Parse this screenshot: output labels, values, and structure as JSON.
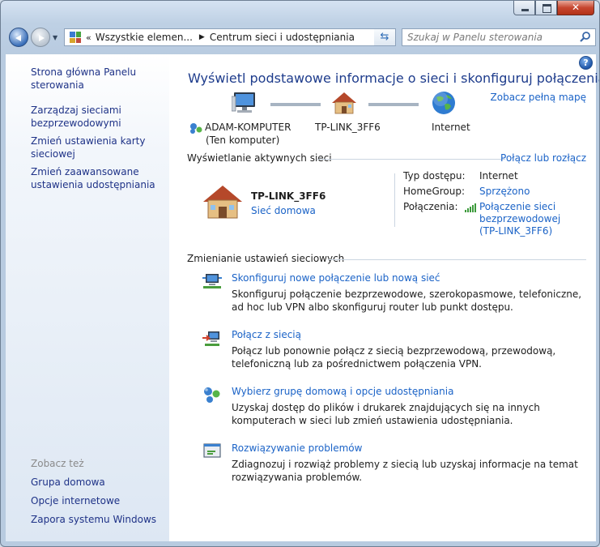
{
  "window": {
    "controls": {
      "minimize": "minimize",
      "maximize": "maximize",
      "close": "close"
    }
  },
  "address_bar": {
    "chevron": "«",
    "crumbs": [
      "Wszystkie elemen...",
      "Centrum sieci i udostępniania"
    ],
    "search_placeholder": "Szukaj w Panelu sterowania"
  },
  "sidebar": {
    "links": [
      "Strona główna Panelu sterowania",
      "Zarządzaj sieciami bezprzewodowymi",
      "Zmień ustawienia karty sieciowej",
      "Zmień zaawansowane ustawienia udostępniania"
    ],
    "see_also_label": "Zobacz też",
    "see_also_links": [
      "Grupa domowa",
      "Opcje internetowe",
      "Zapora systemu Windows"
    ]
  },
  "main": {
    "title": "Wyświetl podstawowe informacje o sieci i skonfiguruj połączenia",
    "full_map_link": "Zobacz pełną mapę",
    "map": {
      "computer_name": "ADAM-KOMPUTER",
      "computer_sub": "(Ten komputer)",
      "network_name": "TP-LINK_3FF6",
      "internet_label": "Internet"
    },
    "active_networks": {
      "header": "Wyświetlanie aktywnych sieci",
      "connect_link": "Połącz lub rozłącz",
      "network_name": "TP-LINK_3FF6",
      "network_type": "Sieć domowa",
      "access_type_label": "Typ dostępu:",
      "access_type_value": "Internet",
      "homegroup_label": "HomeGroup:",
      "homegroup_value": "Sprzężono",
      "connections_label": "Połączenia:",
      "connection_line1": "Połączenie sieci",
      "connection_line2": "bezprzewodowej",
      "connection_line3": "(TP-LINK_3FF6)"
    },
    "change_settings": {
      "header": "Zmienianie ustawień sieciowych",
      "tasks": [
        {
          "title": "Skonfiguruj nowe połączenie lub nową sieć",
          "desc": "Skonfiguruj połączenie bezprzewodowe, szerokopasmowe, telefoniczne, ad hoc lub VPN albo skonfiguruj router lub punkt dostępu."
        },
        {
          "title": "Połącz z siecią",
          "desc": "Połącz lub ponownie połącz z siecią bezprzewodową, przewodową, telefoniczną lub za pośrednictwem połączenia VPN."
        },
        {
          "title": "Wybierz grupę domową i opcje udostępniania",
          "desc": "Uzyskaj dostęp do plików i drukarek znajdujących się na innych komputerach w sieci lub zmień ustawienia udostępniania."
        },
        {
          "title": "Rozwiązywanie problemów",
          "desc": "Zdiagnozuj i rozwiąż problemy z siecią lub uzyskaj informacje na temat rozwiązywania problemów."
        }
      ]
    }
  },
  "colors": {
    "link": "#1b63c7",
    "title": "#1e3c8c",
    "sidebar_link": "#1e3287",
    "close_button": "#c6462f"
  }
}
